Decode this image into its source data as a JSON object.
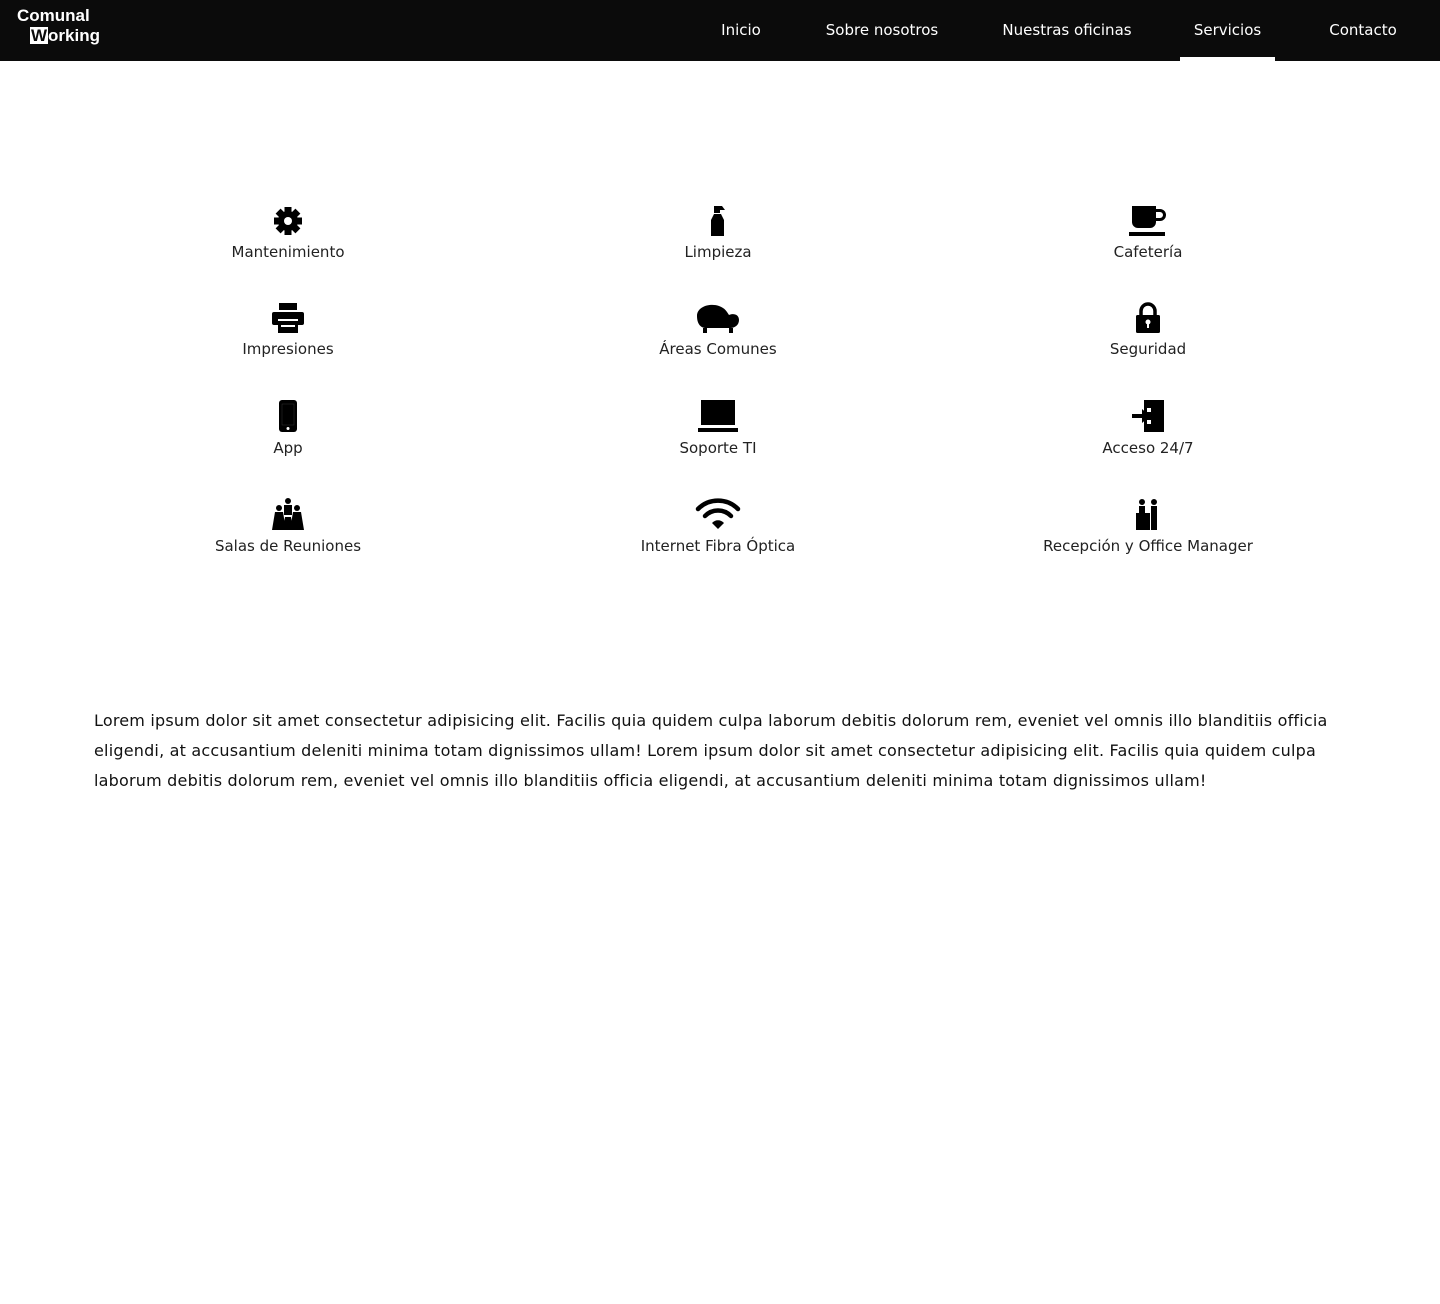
{
  "header": {
    "logo_line1": "Comunal",
    "logo_w": "W",
    "logo_rest": "orking",
    "nav": [
      {
        "label": "Inicio"
      },
      {
        "label": "Sobre nosotros"
      },
      {
        "label": "Nuestras oficinas"
      },
      {
        "label": "Servicios",
        "active": true
      },
      {
        "label": "Contacto"
      }
    ]
  },
  "services": [
    {
      "label": "Mantenimiento",
      "icon": "gear-icon"
    },
    {
      "label": "Limpieza",
      "icon": "spray-bottle-icon"
    },
    {
      "label": "Cafetería",
      "icon": "coffee-cup-icon"
    },
    {
      "label": "Impresiones",
      "icon": "printer-icon"
    },
    {
      "label": "Áreas Comunes",
      "icon": "sofa-icon"
    },
    {
      "label": "Seguridad",
      "icon": "lock-icon"
    },
    {
      "label": "App",
      "icon": "smartphone-icon"
    },
    {
      "label": "Soporte TI",
      "icon": "laptop-icon"
    },
    {
      "label": "Acceso 24/7",
      "icon": "door-enter-icon"
    },
    {
      "label": "Salas de Reuniones",
      "icon": "meeting-people-icon"
    },
    {
      "label": "Internet Fibra Óptica",
      "icon": "wifi-icon"
    },
    {
      "label": "Recepción y Office Manager",
      "icon": "reception-desk-icon"
    }
  ],
  "body_text": "Lorem ipsum dolor sit amet consectetur adipisicing elit. Facilis quia quidem culpa laborum debitis dolorum rem, eveniet vel omnis illo blanditiis officia eligendi, at accusantium deleniti minima totam dignissimos ullam! Lorem ipsum dolor sit amet consectetur adipisicing elit. Facilis quia quidem culpa laborum debitis dolorum rem, eveniet vel omnis illo blanditiis officia eligendi, at accusantium deleniti minima totam dignissimos ullam!"
}
